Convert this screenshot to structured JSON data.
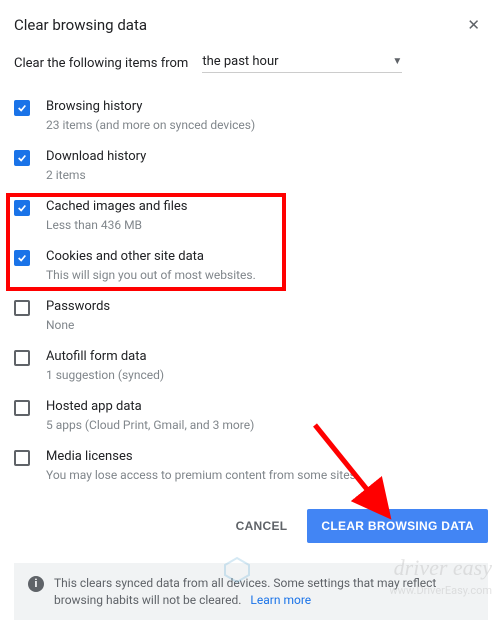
{
  "header": {
    "title": "Clear browsing data"
  },
  "timeRange": {
    "label": "Clear the following items from",
    "value": "the past hour"
  },
  "items": [
    {
      "label": "Browsing history",
      "sub": "23 items (and more on synced devices)",
      "checked": true
    },
    {
      "label": "Download history",
      "sub": "2 items",
      "checked": true
    },
    {
      "label": "Cached images and files",
      "sub": "Less than 436 MB",
      "checked": true
    },
    {
      "label": "Cookies and other site data",
      "sub": "This will sign you out of most websites.",
      "checked": true
    },
    {
      "label": "Passwords",
      "sub": "None",
      "checked": false
    },
    {
      "label": "Autofill form data",
      "sub": "1 suggestion (synced)",
      "checked": false
    },
    {
      "label": "Hosted app data",
      "sub": "5 apps (Cloud Print, Gmail, and 3 more)",
      "checked": false
    },
    {
      "label": "Media licenses",
      "sub": "You may lose access to premium content from some sites.",
      "checked": false
    }
  ],
  "buttons": {
    "cancel": "CANCEL",
    "clear": "CLEAR BROWSING DATA"
  },
  "footer": {
    "text": "This clears synced data from all devices. Some settings that may reflect browsing habits will not be cleared.",
    "learnMore": "Learn more"
  },
  "watermark": {
    "brand": "driver easy",
    "url": "www.DriverEasy.com"
  }
}
